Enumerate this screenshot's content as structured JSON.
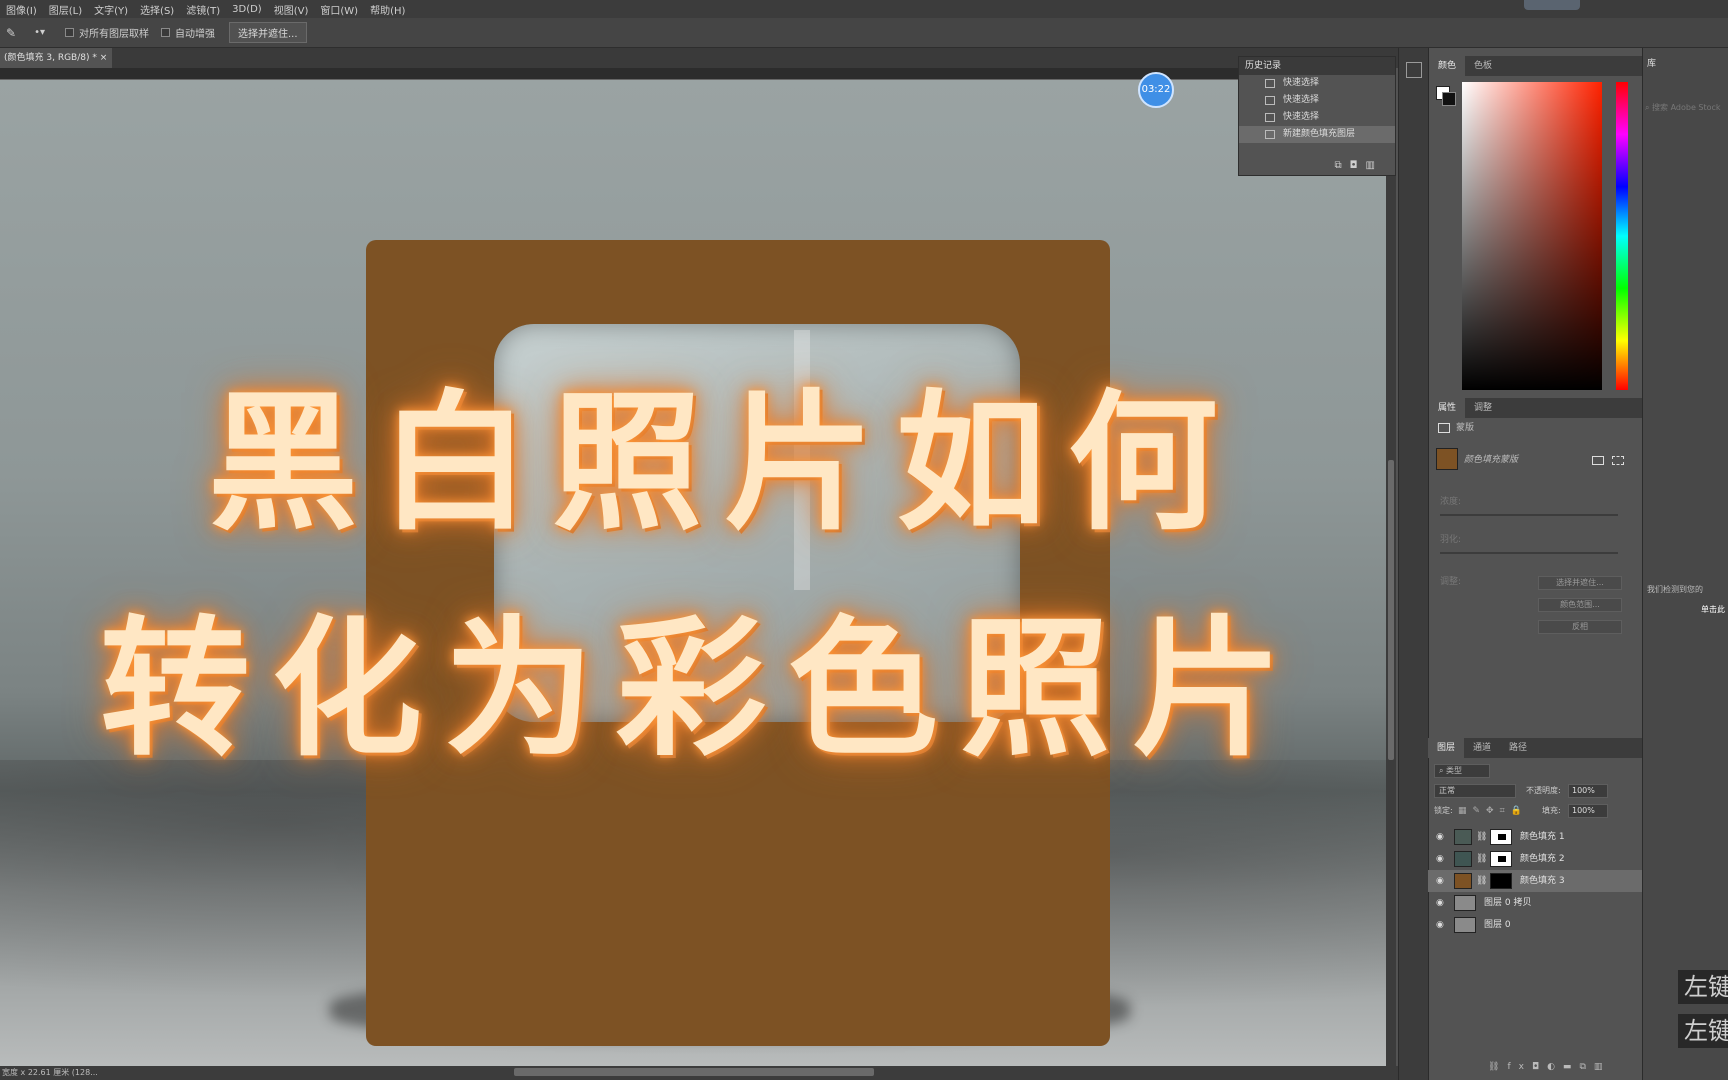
{
  "menu": [
    "图像(I)",
    "图层(L)",
    "文字(Y)",
    "选择(S)",
    "滤镜(T)",
    "3D(D)",
    "视图(V)",
    "窗口(W)",
    "帮助(H)"
  ],
  "options": {
    "sample_all_layers": "对所有图层取样",
    "auto_enhance": "自动增强",
    "select_and_mask": "选择并遮住..."
  },
  "document_tab": "(颜色填充 3, RGB/8) *",
  "timer": "03:22",
  "overlay_title": {
    "line1": "黑白照片如何",
    "line2": "转化为彩色照片"
  },
  "history": {
    "title": "历史记录",
    "items": [
      "快速选择",
      "快速选择",
      "快速选择",
      "新建颜色填充图层"
    ],
    "selected_index": 3
  },
  "color_panel": {
    "tabs": [
      "颜色",
      "色板"
    ],
    "foreground": "#ffffff",
    "background": "#111111"
  },
  "library_panel": {
    "tab": "库",
    "search_placeholder": "搜索 Adobe Stock",
    "help_text": "我们检测到您的",
    "link_text": "单击此"
  },
  "properties": {
    "tabs": [
      "属性",
      "调整"
    ],
    "type_label": "蒙版",
    "mask_label": "颜色填充蒙版",
    "density_label": "浓度:",
    "feather_label": "羽化:",
    "refine_label": "调整:",
    "buttons": [
      "选择并遮住...",
      "颜色范围...",
      "反相"
    ]
  },
  "layers": {
    "tabs": [
      "图层",
      "通道",
      "路径"
    ],
    "filter": "类型",
    "blend_mode": "正常",
    "opacity_label": "不透明度:",
    "opacity": "100%",
    "lock_label": "锁定:",
    "fill_label": "填充:",
    "fill": "100%",
    "items": [
      {
        "name": "颜色填充 1",
        "color": "#4a5a55",
        "selected": false,
        "kind": "fill"
      },
      {
        "name": "颜色填充 2",
        "color": "#3f5552",
        "selected": false,
        "kind": "fill"
      },
      {
        "name": "颜色填充 3",
        "color": "#7d5224",
        "selected": true,
        "kind": "fill"
      },
      {
        "name": "图层 0 拷贝",
        "color": "#8a8a8a",
        "selected": false,
        "kind": "image"
      },
      {
        "name": "图层 0",
        "color": "#8a8a8a",
        "selected": false,
        "kind": "image"
      }
    ]
  },
  "hotkeys": [
    "左键",
    "左键"
  ],
  "status": "宽度 x 22.61 厘米 (128..."
}
